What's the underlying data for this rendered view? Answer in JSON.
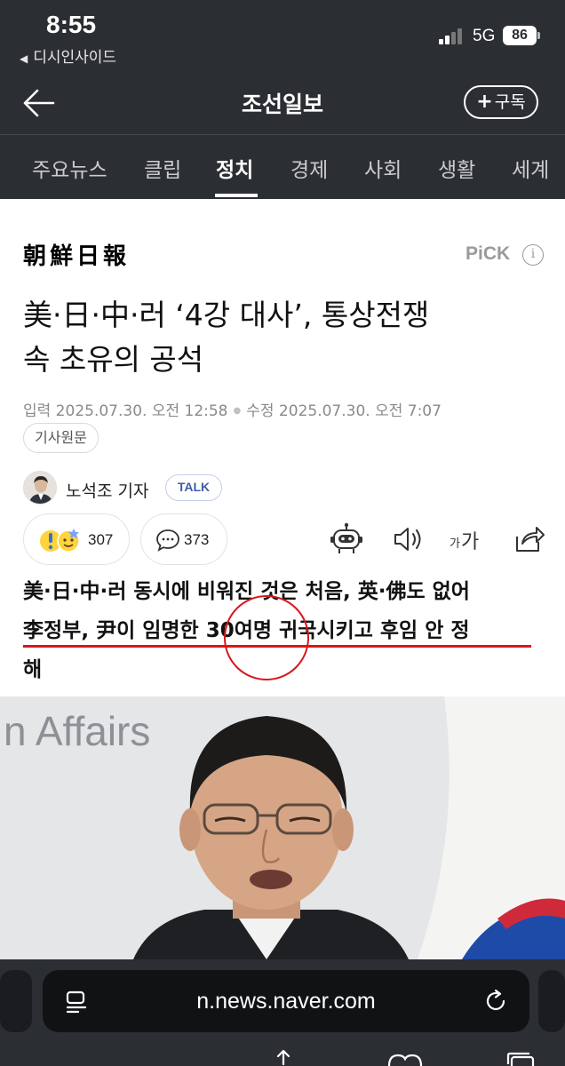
{
  "status_bar": {
    "time": "8:55",
    "back_app": "디시인사이드",
    "network": "5G",
    "battery": "86"
  },
  "header": {
    "back_icon": "arrow-left-icon",
    "title": "조선일보",
    "subscribe_label": "구독"
  },
  "tabs": [
    "주요뉴스",
    "클립",
    "정치",
    "경제",
    "사회",
    "생활",
    "세계"
  ],
  "active_tab": "정치",
  "article": {
    "press_logo": "朝鮮日報",
    "pick_label": "PiCK",
    "headline_line1": "美·日·中·러 ‘4강 대사’, 통상전쟁",
    "headline_line2": "속 초유의 공석",
    "input_date": "입력 2025.07.30. 오전 12:58",
    "modified_date": "수정 2025.07.30. 오전 7:07",
    "original_label": "기사원문",
    "reporter": "노석조 기자",
    "talk_label": "TALK",
    "reaction_count": "307",
    "comment_count": "373",
    "font_size_label": "가가",
    "subhead_line1": "美·日·中·러 동시에 비워진 것은 처음, 英·佛도 없어",
    "subhead_line2": "李정부, 尹이 임명한 30여명 귀국시키고 후임 안 정",
    "subhead_line3": "해",
    "photo_text": "n Affairs"
  },
  "browser": {
    "url": "n.news.naver.com"
  },
  "colors": {
    "chrome_bg": "#2b2e33",
    "highlight_red": "#d7171c",
    "talk_blue": "#3f5ea8"
  }
}
